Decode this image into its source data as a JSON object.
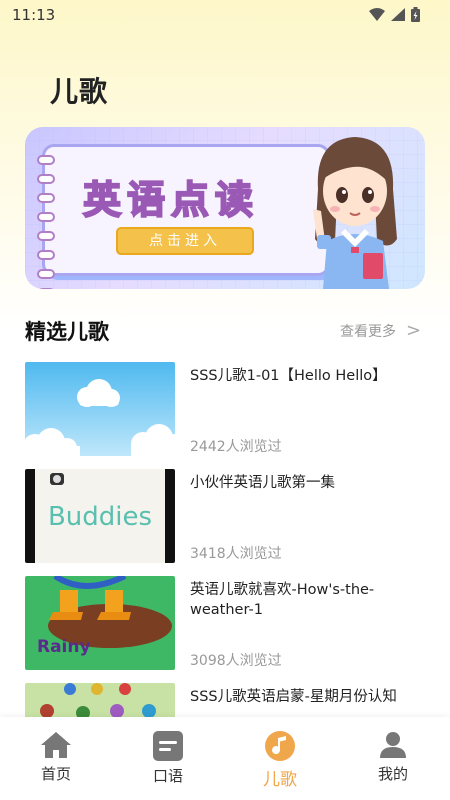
{
  "status_bar": {
    "time": "11:13"
  },
  "header": {
    "title": "儿歌"
  },
  "banner": {
    "title": "英语点读",
    "button_label": "点击进入"
  },
  "section": {
    "title": "精选儿歌",
    "more_label": "查看更多",
    "more_arrow": ">"
  },
  "songs": [
    {
      "title": "SSS儿歌1-01【Hello Hello】",
      "views": "2442人浏览过",
      "thumb": "sky-clouds"
    },
    {
      "title": "小伙伴英语儿歌第一集",
      "views": "3418人浏览过",
      "thumb": "buddies",
      "thumb_text": "Buddies"
    },
    {
      "title": "英语儿歌就喜欢-How's-the-weather-1",
      "views": "3098人浏览过",
      "thumb": "rainy",
      "thumb_text": "Rainy"
    },
    {
      "title": "SSS儿歌英语启蒙-星期月份认知",
      "views": "",
      "thumb": "owls"
    }
  ],
  "nav": [
    {
      "label": "首页",
      "icon": "home-icon",
      "active": false
    },
    {
      "label": "口语",
      "icon": "speech-icon",
      "active": false
    },
    {
      "label": "儿歌",
      "icon": "music-note-icon",
      "active": true
    },
    {
      "label": "我的",
      "icon": "user-icon",
      "active": false
    }
  ],
  "colors": {
    "accent": "#f0a64a",
    "muted": "#999999"
  }
}
